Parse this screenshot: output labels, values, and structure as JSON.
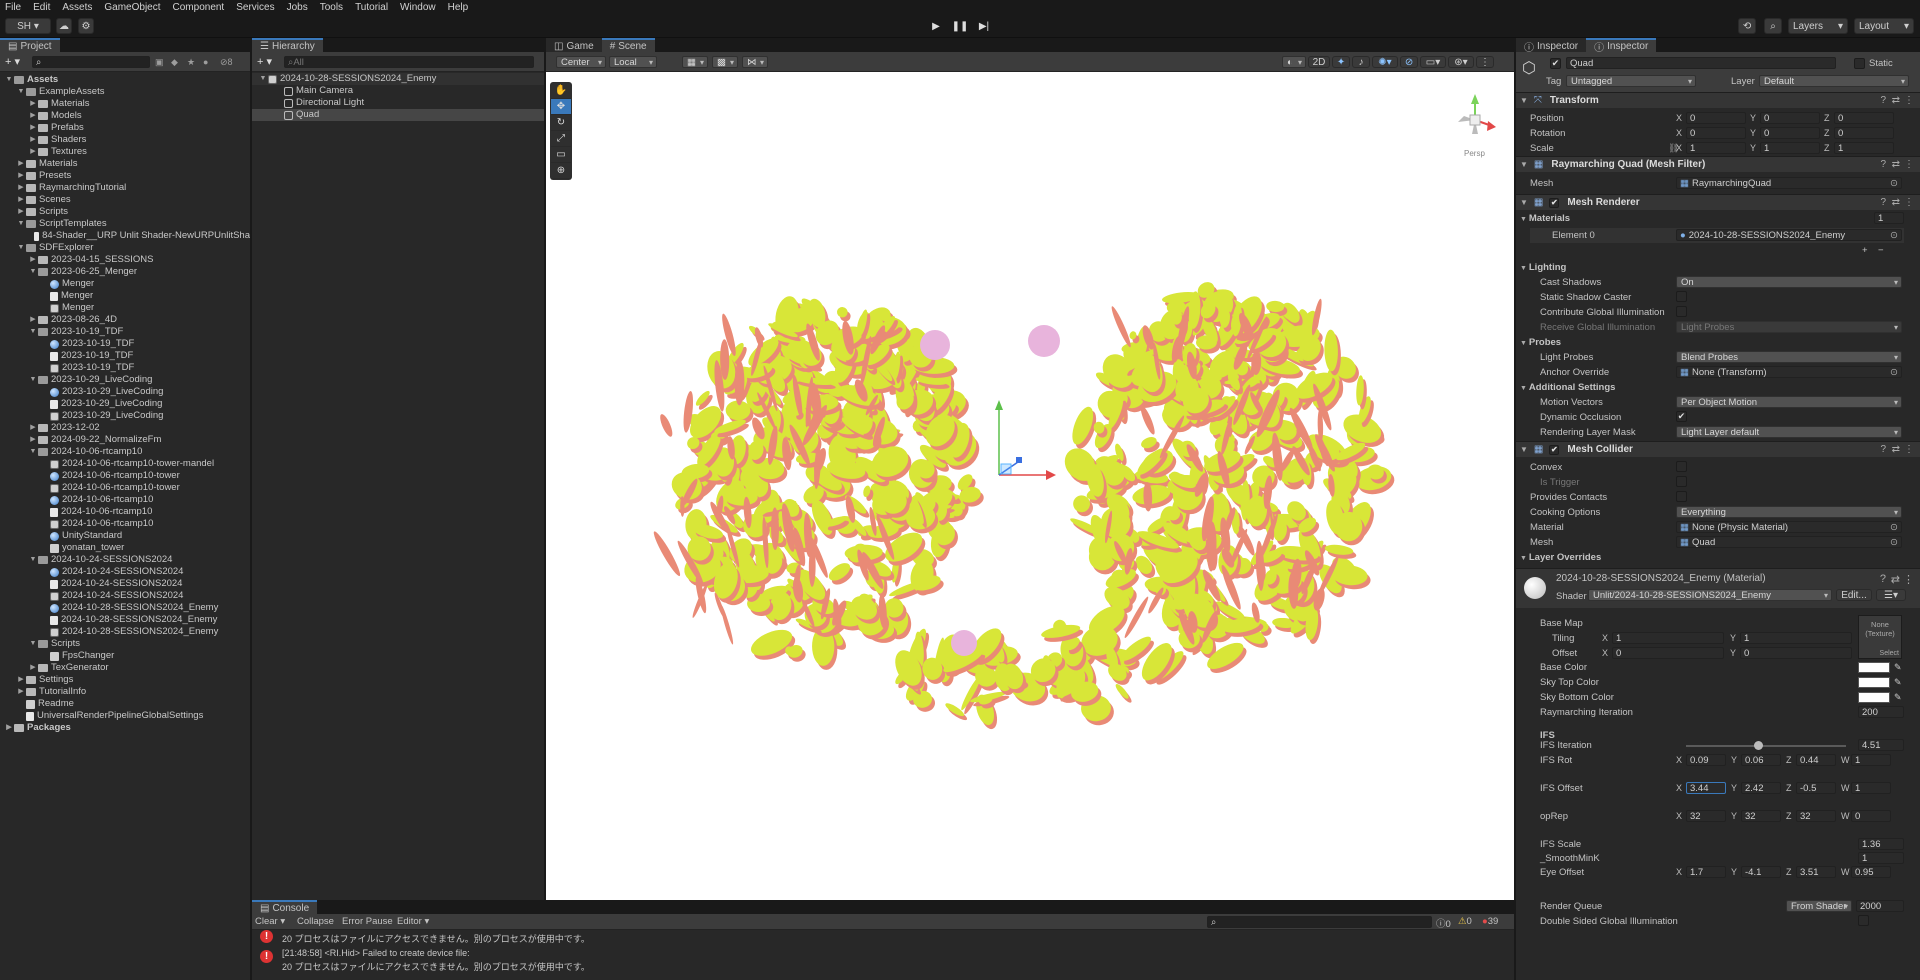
{
  "menu": [
    "File",
    "Edit",
    "Assets",
    "GameObject",
    "Component",
    "Services",
    "Jobs",
    "Tools",
    "Tutorial",
    "Window",
    "Help"
  ],
  "toolbar": {
    "account": "SH",
    "layers": "Layers",
    "layout": "Layout"
  },
  "project": {
    "tab": "Project",
    "search_count": "8",
    "tree": [
      {
        "d": 0,
        "t": "Assets",
        "k": "folder",
        "o": true,
        "b": true
      },
      {
        "d": 1,
        "t": "ExampleAssets",
        "k": "folder",
        "o": true
      },
      {
        "d": 2,
        "t": "Materials",
        "k": "folder"
      },
      {
        "d": 2,
        "t": "Models",
        "k": "folder"
      },
      {
        "d": 2,
        "t": "Prefabs",
        "k": "folder"
      },
      {
        "d": 2,
        "t": "Shaders",
        "k": "folder"
      },
      {
        "d": 2,
        "t": "Textures",
        "k": "folder"
      },
      {
        "d": 1,
        "t": "Materials",
        "k": "folder"
      },
      {
        "d": 1,
        "t": "Presets",
        "k": "folder"
      },
      {
        "d": 1,
        "t": "RaymarchingTutorial",
        "k": "folder"
      },
      {
        "d": 1,
        "t": "Scenes",
        "k": "folder"
      },
      {
        "d": 1,
        "t": "Scripts",
        "k": "folder"
      },
      {
        "d": 1,
        "t": "ScriptTemplates",
        "k": "folder",
        "o": true
      },
      {
        "d": 2,
        "t": "84-Shader__URP Unlit Shader-NewURPUnlitSha",
        "k": "shader",
        "n": true
      },
      {
        "d": 1,
        "t": "SDFExplorer",
        "k": "folder",
        "o": true
      },
      {
        "d": 2,
        "t": "2023-04-15_SESSIONS",
        "k": "folder"
      },
      {
        "d": 2,
        "t": "2023-06-25_Menger",
        "k": "folder",
        "o": true
      },
      {
        "d": 3,
        "t": "Menger",
        "k": "mat"
      },
      {
        "d": 3,
        "t": "Menger",
        "k": "shader"
      },
      {
        "d": 3,
        "t": "Menger",
        "k": "scene"
      },
      {
        "d": 2,
        "t": "2023-08-26_4D",
        "k": "folder"
      },
      {
        "d": 2,
        "t": "2023-10-19_TDF",
        "k": "folder",
        "o": true
      },
      {
        "d": 3,
        "t": "2023-10-19_TDF",
        "k": "mat"
      },
      {
        "d": 3,
        "t": "2023-10-19_TDF",
        "k": "shader"
      },
      {
        "d": 3,
        "t": "2023-10-19_TDF",
        "k": "scene"
      },
      {
        "d": 2,
        "t": "2023-10-29_LiveCoding",
        "k": "folder",
        "o": true
      },
      {
        "d": 3,
        "t": "2023-10-29_LiveCoding",
        "k": "mat"
      },
      {
        "d": 3,
        "t": "2023-10-29_LiveCoding",
        "k": "shader"
      },
      {
        "d": 3,
        "t": "2023-10-29_LiveCoding",
        "k": "scene"
      },
      {
        "d": 2,
        "t": "2023-12-02",
        "k": "folder"
      },
      {
        "d": 2,
        "t": "2024-09-22_NormalizeFm",
        "k": "folder"
      },
      {
        "d": 2,
        "t": "2024-10-06-rtcamp10",
        "k": "folder",
        "o": true
      },
      {
        "d": 3,
        "t": "2024-10-06-rtcamp10-tower-mandel",
        "k": "scene"
      },
      {
        "d": 3,
        "t": "2024-10-06-rtcamp10-tower",
        "k": "mat"
      },
      {
        "d": 3,
        "t": "2024-10-06-rtcamp10-tower",
        "k": "scene"
      },
      {
        "d": 3,
        "t": "2024-10-06-rtcamp10",
        "k": "mat"
      },
      {
        "d": 3,
        "t": "2024-10-06-rtcamp10",
        "k": "shader"
      },
      {
        "d": 3,
        "t": "2024-10-06-rtcamp10",
        "k": "scene"
      },
      {
        "d": 3,
        "t": "UnityStandard",
        "k": "mat"
      },
      {
        "d": 3,
        "t": "yonatan_tower",
        "k": "cs"
      },
      {
        "d": 2,
        "t": "2024-10-24-SESSIONS2024",
        "k": "folder",
        "o": true
      },
      {
        "d": 3,
        "t": "2024-10-24-SESSIONS2024",
        "k": "mat"
      },
      {
        "d": 3,
        "t": "2024-10-24-SESSIONS2024",
        "k": "shader"
      },
      {
        "d": 3,
        "t": "2024-10-24-SESSIONS2024",
        "k": "scene"
      },
      {
        "d": 3,
        "t": "2024-10-28-SESSIONS2024_Enemy",
        "k": "mat"
      },
      {
        "d": 3,
        "t": "2024-10-28-SESSIONS2024_Enemy",
        "k": "shader"
      },
      {
        "d": 3,
        "t": "2024-10-28-SESSIONS2024_Enemy",
        "k": "scene"
      },
      {
        "d": 2,
        "t": "Scripts",
        "k": "folder",
        "o": true
      },
      {
        "d": 3,
        "t": "FpsChanger",
        "k": "cs"
      },
      {
        "d": 2,
        "t": "TexGenerator",
        "k": "folder"
      },
      {
        "d": 1,
        "t": "Settings",
        "k": "folder"
      },
      {
        "d": 1,
        "t": "TutorialInfo",
        "k": "folder"
      },
      {
        "d": 1,
        "t": "Readme",
        "k": "cs",
        "n": true
      },
      {
        "d": 1,
        "t": "UniversalRenderPipelineGlobalSettings",
        "k": "shader",
        "n": true
      },
      {
        "d": 0,
        "t": "Packages",
        "k": "folder",
        "b": true
      }
    ]
  },
  "hierarchy": {
    "tab": "Hierarchy",
    "search_placeholder": "All",
    "scene": "2024-10-28-SESSIONS2024_Enemy",
    "items": [
      "Main Camera",
      "Directional Light",
      "Quad"
    ]
  },
  "scene_view": {
    "tabs": [
      "Game",
      "Scene"
    ],
    "pivot": "Center",
    "space": "Local",
    "mode_2d": "2D",
    "persp": "Persp"
  },
  "console": {
    "tab": "Console",
    "buttons": [
      "Clear",
      "Collapse",
      "Error Pause",
      "Editor"
    ],
    "counts": {
      "info": "0",
      "warn": "0",
      "error": "39"
    },
    "lines": [
      "20 プロセスはファイルにアクセスできません。別のプロセスが使用中です。",
      "[21:48:58] <RI.Hid> Failed to create device file:",
      "20 プロセスはファイルにアクセスできません。別のプロセスが使用中です。"
    ]
  },
  "inspector": {
    "tabs": [
      "Inspector",
      "Inspector"
    ],
    "object_name": "Quad",
    "static_label": "Static",
    "tag_label": "Tag",
    "tag_value": "Untagged",
    "layer_label": "Layer",
    "layer_value": "Default",
    "transform": {
      "title": "Transform",
      "rows": [
        {
          "label": "Position",
          "x": "0",
          "y": "0",
          "z": "0"
        },
        {
          "label": "Rotation",
          "x": "0",
          "y": "0",
          "z": "0"
        },
        {
          "label": "Scale",
          "x": "1",
          "y": "1",
          "z": "1"
        }
      ]
    },
    "mesh_filter": {
      "title": "Raymarching Quad (Mesh Filter)",
      "mesh_label": "Mesh",
      "mesh_value": "RaymarchingQuad"
    },
    "mesh_renderer": {
      "title": "Mesh Renderer",
      "materials_label": "Materials",
      "materials_count": "1",
      "element_label": "Element 0",
      "element_value": "2024-10-28-SESSIONS2024_Enemy",
      "lighting": "Lighting",
      "cast_shadows_label": "Cast Shadows",
      "cast_shadows": "On",
      "static_shadow": "Static Shadow Caster",
      "contrib_gi": "Contribute Global Illumination",
      "receive_gi_label": "Receive Global Illumination",
      "receive_gi": "Light Probes",
      "probes": "Probes",
      "light_probes_label": "Light Probes",
      "light_probes": "Blend Probes",
      "anchor_label": "Anchor Override",
      "anchor": "None (Transform)",
      "additional": "Additional Settings",
      "motion_label": "Motion Vectors",
      "motion": "Per Object Motion",
      "dyn_occ": "Dynamic Occlusion",
      "rlm_label": "Rendering Layer Mask",
      "rlm": "Light Layer default"
    },
    "mesh_collider": {
      "title": "Mesh Collider",
      "convex": "Convex",
      "trigger": "Is Trigger",
      "contacts": "Provides Contacts",
      "cooking_label": "Cooking Options",
      "cooking": "Everything",
      "material_label": "Material",
      "material": "None (Physic Material)",
      "mesh_label": "Mesh",
      "mesh": "Quad",
      "layer_overrides": "Layer Overrides"
    },
    "material": {
      "title": "2024-10-28-SESSIONS2024_Enemy (Material)",
      "shader_label": "Shader",
      "shader": "Unlit/2024-10-28-SESSIONS2024_Enemy",
      "edit": "Edit...",
      "base_map": "Base Map",
      "tex_none": "None",
      "tex_type": "(Texture)",
      "select": "Select",
      "tiling_label": "Tiling",
      "tiling_x": "1",
      "tiling_y": "1",
      "offset_label": "Offset",
      "offset_x": "0",
      "offset_y": "0",
      "base_color": "Base Color",
      "sky_top": "Sky Top Color",
      "sky_bottom": "Sky Bottom Color",
      "ray_iter_label": "Raymarching Iteration",
      "ray_iter": "200",
      "ifs_header": "IFS",
      "ifs_iter_label": "IFS Iteration",
      "ifs_iter": "4.51",
      "ifs_iter_fraction": 0.45,
      "ifs_rot_label": "IFS Rot",
      "ifs_rot": {
        "x": "0.09",
        "y": "0.06",
        "z": "0.44",
        "w": "1"
      },
      "ifs_offset_label": "IFS Offset",
      "ifs_offset": {
        "x": "3.44",
        "y": "2.42",
        "z": "-0.5",
        "w": "1"
      },
      "oprep_label": "opRep",
      "oprep": {
        "x": "32",
        "y": "32",
        "z": "32",
        "w": "0"
      },
      "ifs_scale_label": "IFS Scale",
      "ifs_scale": "1.36",
      "smooth_label": "_SmoothMinK",
      "smooth": "1",
      "eye_label": "Eye Offset",
      "eye": {
        "x": "1.7",
        "y": "-4.1",
        "z": "3.51",
        "w": "0.95"
      },
      "render_queue_label": "Render Queue",
      "render_queue_mode": "From Shader",
      "render_queue": "2000",
      "dsgi": "Double Sided Global Illumination"
    }
  },
  "colors": {
    "accent": "#3a79bb",
    "blob_yellow": "#d8e638",
    "blob_red": "#e98a76",
    "sphere_pink": "#e8b4dc"
  }
}
